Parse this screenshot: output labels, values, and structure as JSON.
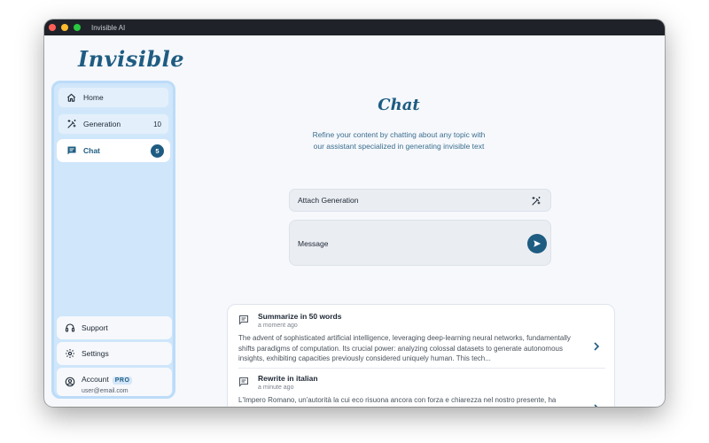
{
  "window": {
    "title": "Invisible AI"
  },
  "brand": {
    "logo_text": "Invisible"
  },
  "sidebar": {
    "items": [
      {
        "label": "Home",
        "icon": "home-icon"
      },
      {
        "label": "Generation",
        "icon": "magic-wand-icon",
        "count": "10"
      },
      {
        "label": "Chat",
        "icon": "chat-icon",
        "badge": "5",
        "active": true
      }
    ],
    "bottom": {
      "support_label": "Support",
      "settings_label": "Settings",
      "account_label": "Account",
      "account_badge": "PRO",
      "account_email": "user@email.com"
    }
  },
  "main": {
    "title": "Chat",
    "subtitle": "Refine your content by chatting about any topic with our assistant specialized in generating invisible text",
    "attach_label": "Attach Generation",
    "message_placeholder": "Message",
    "history": [
      {
        "title": "Summarize in 50 words",
        "time": "a moment ago",
        "text": "The advent of sophisticated artificial intelligence, leveraging deep-learning neural networks, fundamentally shifts paradigms of computation. Its crucial power: analyzing colossal datasets to generate autonomous insights, exhibiting capacities previously considered uniquely human. This tech..."
      },
      {
        "title": "Rewrite in italian",
        "time": "a minute ago",
        "text": "L'Impero Romano, un'autorità la cui eco risuona ancora con forza e chiarezza nel nostro presente, ha"
      }
    ]
  },
  "colors": {
    "accent": "#1e5c82",
    "sidebar_bg": "#cfe6fb",
    "content_bg": "#f6f8fc"
  }
}
